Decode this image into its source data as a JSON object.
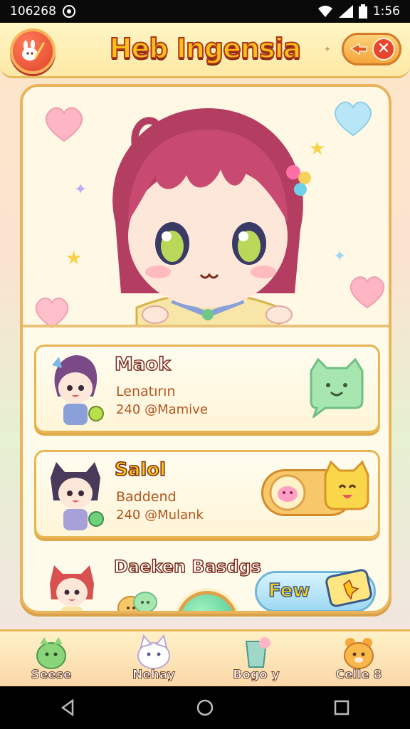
{
  "status_bar": {
    "left_text": "106268",
    "time": "1:56"
  },
  "header": {
    "title": "Heb Ingensia",
    "close_symbol": "✕",
    "back_icon": "bunny-flag-icon"
  },
  "entries": [
    {
      "name": "Maok",
      "subtitle": "Lenatırın",
      "stat": "240 @Mamive",
      "badge_icon": "green-cat-bubble-icon"
    },
    {
      "name": "Salol",
      "subtitle": "Baddend",
      "stat": "240 @Mulank",
      "badge_icon": "pink-pig-coin-icon"
    },
    {
      "name": "Daeken Basdgs",
      "action_label": "Few",
      "badge_icon": "slime-pair-icon"
    }
  ],
  "bottom_nav": [
    {
      "label": "Seese",
      "icon": "green-cactus-cat-icon"
    },
    {
      "label": "Nehay",
      "icon": "white-cat-icon"
    },
    {
      "label": "Bogo y",
      "icon": "blue-cup-icon"
    },
    {
      "label": "Celle 8",
      "icon": "orange-bear-icon"
    }
  ],
  "colors": {
    "accent_gold": "#f6c21a",
    "accent_red": "#e2452a",
    "panel_border": "#e9b45c",
    "text_brown": "#b5531e"
  }
}
